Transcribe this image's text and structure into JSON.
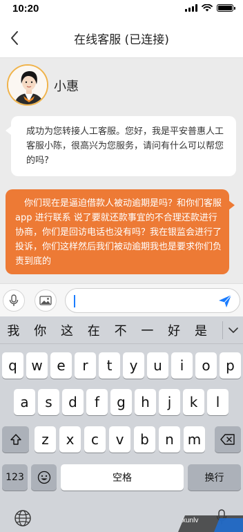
{
  "status_bar": {
    "time": "10:20"
  },
  "nav": {
    "title": "在线客服 (已连接)"
  },
  "agent": {
    "name": "小惠"
  },
  "messages": [
    {
      "from": "agent",
      "text": "成功为您转接人工客服。您好，我是平安普惠人工客服小陈，很高兴为您服务，请问有什么可以帮您的吗?"
    },
    {
      "from": "user",
      "text": "你们现在是逼迫借款人被动逾期是吗？和你们客服 app 进行联系 说了要就还款事宜的不合理还款进行协商，你们是回访电话也没有吗？我在银监会进行了投诉，你们这样然后我们被动逾期我也是要求你们负责到底的"
    }
  ],
  "input": {
    "value": "",
    "placeholder": ""
  },
  "keyboard": {
    "candidates": [
      "我",
      "你",
      "这",
      "在",
      "不",
      "一",
      "好",
      "是"
    ],
    "row1": [
      "q",
      "w",
      "e",
      "r",
      "t",
      "y",
      "u",
      "i",
      "o",
      "p"
    ],
    "row2": [
      "a",
      "s",
      "d",
      "f",
      "g",
      "h",
      "j",
      "k",
      "l"
    ],
    "row3": [
      "z",
      "x",
      "c",
      "v",
      "b",
      "n",
      "m"
    ],
    "numbers_label": "123",
    "space_label": "空格",
    "return_label": "换行"
  },
  "watermark": {
    "text": "xunlv"
  },
  "colors": {
    "accent": "#ed7a35",
    "send": "#1a7cff"
  }
}
